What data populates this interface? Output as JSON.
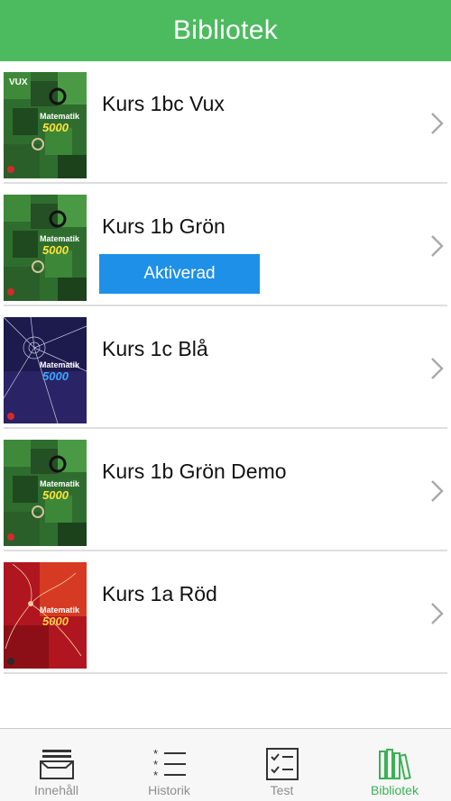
{
  "header": {
    "title": "Bibliotek"
  },
  "library": {
    "items": [
      {
        "title": "Kurs 1bc Vux",
        "cover_text": "Matematik",
        "cover_number": "5000",
        "cover_badge": "VUX",
        "cover_theme": "green"
      },
      {
        "title": "Kurs 1b Grön",
        "cover_text": "Matematik",
        "cover_number": "5000",
        "cover_theme": "green",
        "status_label": "Aktiverad"
      },
      {
        "title": "Kurs 1c Blå",
        "cover_text": "Matematik",
        "cover_number": "5000",
        "cover_theme": "blue"
      },
      {
        "title": "Kurs 1b Grön Demo",
        "cover_text": "Matematik",
        "cover_number": "5000",
        "cover_theme": "green"
      },
      {
        "title": "Kurs 1a Röd",
        "cover_text": "Matematik",
        "cover_number": "5000",
        "cover_theme": "red"
      }
    ]
  },
  "tabbar": {
    "tabs": [
      {
        "label": "Innehåll",
        "icon": "tray-icon"
      },
      {
        "label": "Historik",
        "icon": "list-icon"
      },
      {
        "label": "Test",
        "icon": "checklist-icon"
      },
      {
        "label": "Bibliotek",
        "icon": "books-icon",
        "active": true
      }
    ]
  },
  "colors": {
    "accent": "#4cbb5f",
    "active_tab": "#3bb154",
    "badge": "#1e90e8"
  }
}
